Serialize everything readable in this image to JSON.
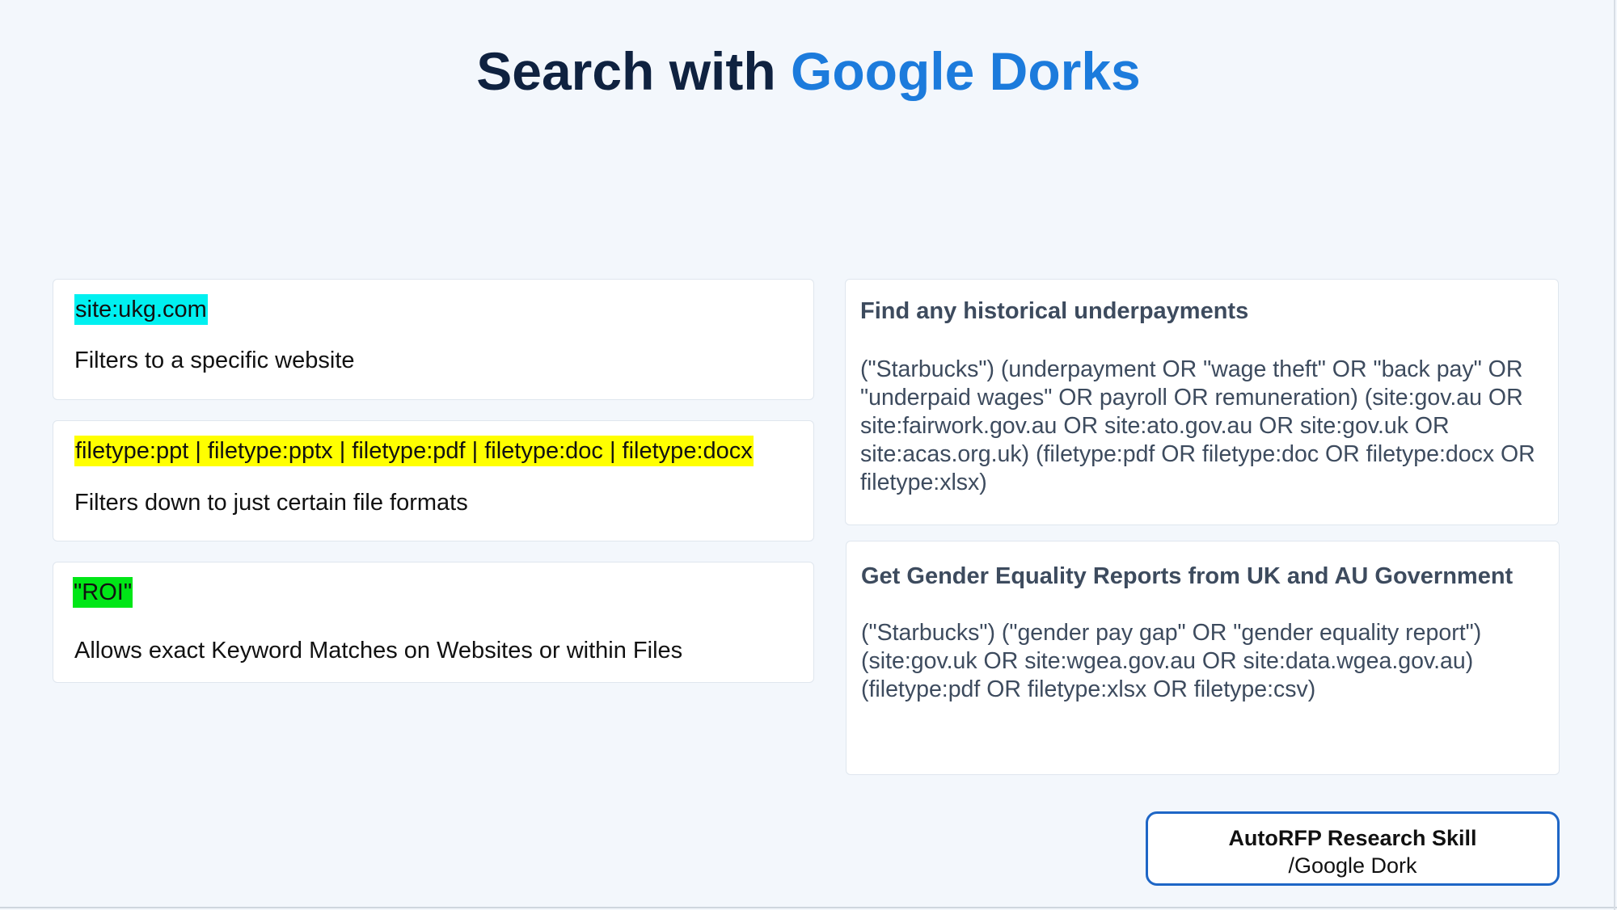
{
  "title": {
    "prefix": "Search with ",
    "accent": "Google Dorks"
  },
  "tips": [
    {
      "code": "site:ukg.com",
      "description": "Filters to a specific website",
      "highlight": "#00f0f0"
    },
    {
      "code": "filetype:ppt | filetype:pptx | filetype:pdf | filetype:doc | filetype:docx",
      "description": "Filters down to just certain file formats",
      "highlight": "#ffff00"
    },
    {
      "code": "\"ROI\"",
      "description": "Allows exact Keyword Matches on Websites or within Files",
      "highlight": "#00e617"
    }
  ],
  "examples": [
    {
      "heading": "Find any historical underpayments",
      "query": "(\"Starbucks\") (underpayment OR \"wage theft\" OR \"back pay\" OR \"underpaid wages\" OR payroll OR remuneration) (site:gov.au OR site:fairwork.gov.au OR site:ato.gov.au OR site:gov.uk OR site:acas.org.uk) (filetype:pdf OR filetype:doc OR filetype:docx OR filetype:xlsx)"
    },
    {
      "heading": "Get Gender Equality Reports from UK and AU Government",
      "query": "(\"Starbucks\") (\"gender pay gap\" OR \"gender equality report\") (site:gov.uk OR site:wgea.gov.au OR site:data.wgea.gov.au) (filetype:pdf OR filetype:xlsx OR filetype:csv)"
    }
  ],
  "badge": {
    "title": "AutoRFP Research Skill",
    "subtitle": "/Google Dork"
  },
  "colors": {
    "background": "#f3f7fc",
    "title": "#0f2240",
    "accent": "#1c7bdc",
    "badge_border": "#1e66c6"
  }
}
